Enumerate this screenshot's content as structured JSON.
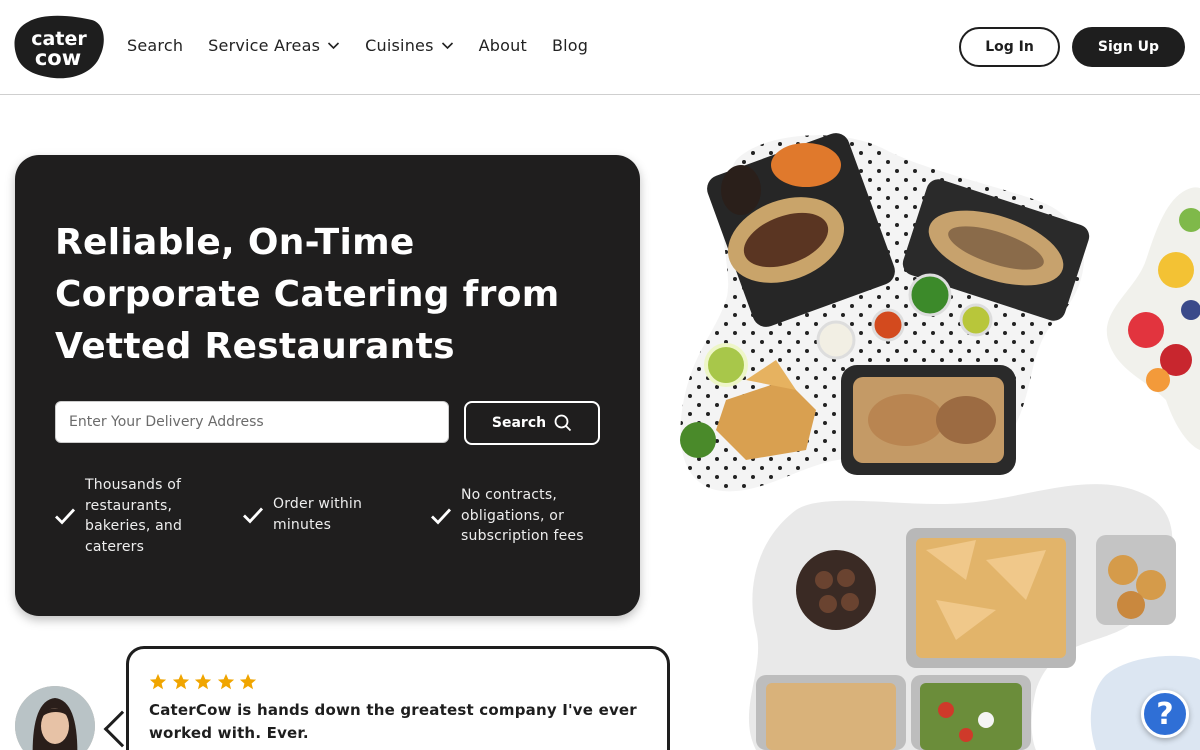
{
  "header": {
    "logo_line1": "cater",
    "logo_line2": "cow",
    "nav": [
      {
        "label": "Search",
        "has_dropdown": false
      },
      {
        "label": "Service Areas",
        "has_dropdown": true
      },
      {
        "label": "Cuisines",
        "has_dropdown": true
      },
      {
        "label": "About",
        "has_dropdown": false
      },
      {
        "label": "Blog",
        "has_dropdown": false
      }
    ],
    "login_label": "Log In",
    "signup_label": "Sign Up"
  },
  "hero": {
    "title_line1": "Reliable, On-Time",
    "title_line2": "Corporate Catering from",
    "title_line3": "Vetted Restaurants",
    "address_placeholder": "Enter Your Delivery Address",
    "address_value": "",
    "search_label": "Search",
    "features": [
      {
        "text": "Thousands of restaurants, bakeries, and caterers"
      },
      {
        "text": "Order within minutes"
      },
      {
        "text": "No contracts, obligations, or subscription fees"
      }
    ]
  },
  "testimonial": {
    "rating": 5,
    "quote": "CaterCow is hands down the greatest company I've ever worked with. Ever."
  },
  "help_widget": {
    "label": "?"
  },
  "colors": {
    "dark": "#1f1e1e",
    "star": "#f0a500",
    "help": "#2f6fd6"
  }
}
